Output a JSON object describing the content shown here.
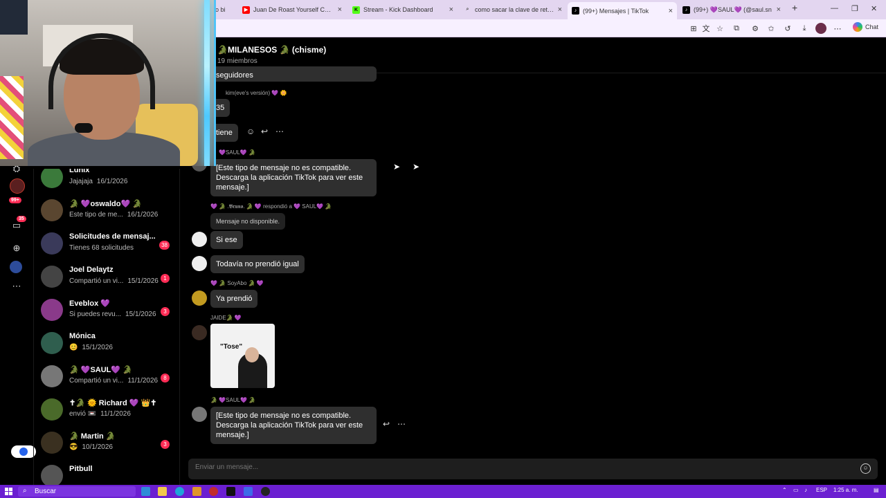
{
  "browser": {
    "tabs": [
      {
        "title": "Juan De Roast Yourself Challenge",
        "favicon": "youtube-icon",
        "color": "#ff0000"
      },
      {
        "title": "Stream - Kick Dashboard",
        "favicon": "kick-icon",
        "color": "#53fc18"
      },
      {
        "title": "como sacar la clave de retransmisión",
        "favicon": "search-icon",
        "color": "#555555"
      },
      {
        "title": "(99+) Mensajes | TikTok",
        "favicon": "tiktok-icon",
        "color": "#000000"
      },
      {
        "title": "(99+) 💜SAUL💜 (@saul.sn",
        "favicon": "tiktok-icon",
        "color": "#000000"
      }
    ],
    "partial_tab_title": "o bi",
    "chat_label": "Chat"
  },
  "chat": {
    "title": "🐊MILANESOS 🐊 (chisme)",
    "members": "19 miembros",
    "messages": [
      {
        "sender": "",
        "text": "seguidores"
      },
      {
        "sender": "kim(eve's versión) 💜 🌼",
        "text": "35"
      },
      {
        "sender": "",
        "text": "tiene"
      },
      {
        "sender": "💜SAUL💜 🐊",
        "text": "[Este tipo de mensaje no es compatible. Descarga la aplicación TikTok para ver este mensaje.]"
      },
      {
        "sender": "💜 🐊 .𝕭𝖗𝖚𝖓𝖔. 🐊 💜",
        "reply_note": "respondió a",
        "reply_target": "💜 SAUL💜 🐊",
        "quoted": "Mensaje no disponible.",
        "text": "Si ese"
      },
      {
        "sender": "",
        "text": "Todavía no prendió igual"
      },
      {
        "sender": "💜 🐊 SoyAbo 🐊 💜",
        "text": "Ya prendió"
      },
      {
        "sender": "JAIDE🐊 💜",
        "sticker_caption": "\"Tose\""
      },
      {
        "sender": "🐊 💜SAUL💜 🐊",
        "text": "[Este tipo de mensaje no es compatible. Descarga la aplicación TikTok para ver este mensaje.]"
      }
    ],
    "composer_placeholder": "Enviar un mensaje..."
  },
  "sidebar": {
    "conversations": [
      {
        "name": "Lunix",
        "preview": "Jajajaja",
        "date": "16/1/2026",
        "badge": "",
        "avatar_color": "#3b7a3b"
      },
      {
        "name": "🐊 💜oswaldo💜 🐊",
        "preview": "Este tipo de me...",
        "date": "16/1/2026",
        "badge": "",
        "avatar_color": "#5a4630"
      },
      {
        "name": "Solicitudes de mensaj...",
        "preview": "Tienes 68 solicitudes",
        "date": "",
        "badge": "38",
        "avatar_color": "#3a3a5a"
      },
      {
        "name": "Joel Delaytz",
        "preview": "Compartió un vi...",
        "date": "15/1/2026",
        "badge": "1",
        "avatar_color": "#444444"
      },
      {
        "name": "Eveblox 💜",
        "preview": "Si puedes revu...",
        "date": "15/1/2026",
        "badge": "3",
        "avatar_color": "#8a3a8a"
      },
      {
        "name": "Mónica",
        "preview": "😊",
        "date": "15/1/2026",
        "badge": "",
        "avatar_color": "#2f5e4e"
      },
      {
        "name": "🐊 💜SAUL💜 🐊",
        "preview": "Compartió un vi...",
        "date": "11/1/2026",
        "badge": "8",
        "avatar_color": "#777777"
      },
      {
        "name": "✝🐊 🌞 Richard 💜 👑✝",
        "preview": "envió 📼",
        "date": "11/1/2026",
        "badge": "",
        "avatar_color": "#4a6a2a"
      },
      {
        "name": "🐊 Martin 🐊",
        "preview": "😎",
        "date": "10/1/2026",
        "badge": "3",
        "avatar_color": "#3a3020"
      },
      {
        "name": "Pitbull",
        "preview": "",
        "date": "",
        "badge": "",
        "avatar_color": "#555555"
      }
    ]
  },
  "rail": {
    "badge_99": "99+",
    "badge_inbox": "35"
  },
  "taskbar": {
    "search_label": "Buscar",
    "lang": "ESP",
    "time": "1:25 a. m."
  }
}
